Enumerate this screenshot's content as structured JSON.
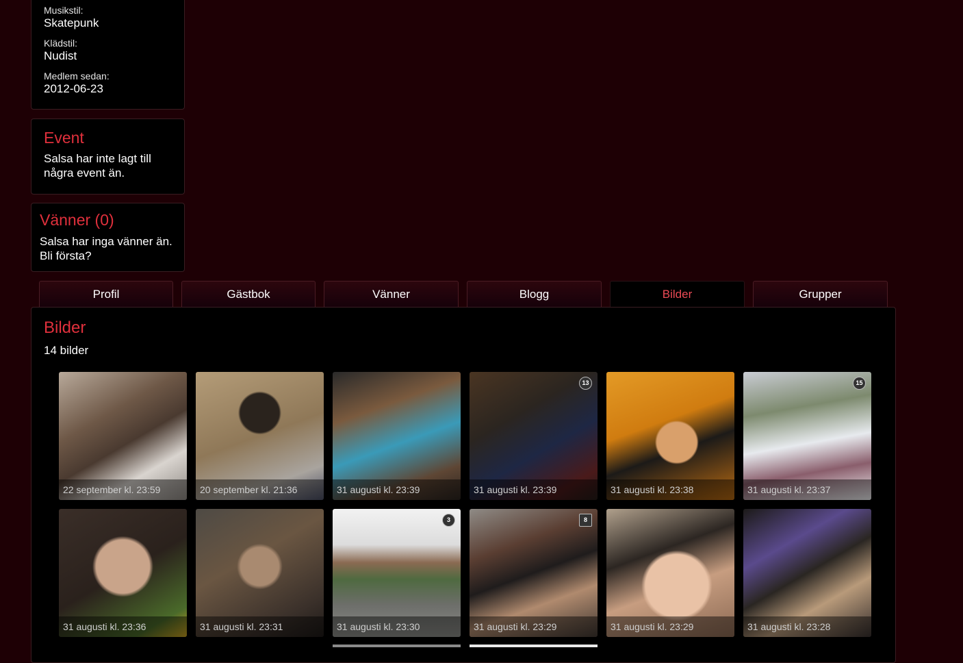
{
  "profile_info": {
    "music_label": "Musikstil:",
    "music_value": "Skatepunk",
    "style_label": "Klädstil:",
    "style_value": "Nudist",
    "member_label": "Medlem sedan:",
    "member_value": "2012-06-23"
  },
  "event": {
    "heading": "Event",
    "text_line1": "Salsa har inte lagt till",
    "text_line2": "några event än."
  },
  "friends_box": {
    "heading": "Vänner (0)",
    "text_line1": "Salsa har inga vänner än.",
    "text_line2": "Bli första?"
  },
  "tabs": [
    {
      "label": "Profil"
    },
    {
      "label": "Gästbok"
    },
    {
      "label": "Vänner"
    },
    {
      "label": "Blogg"
    },
    {
      "label": "Bilder",
      "active": true
    },
    {
      "label": "Grupper"
    }
  ],
  "pictures": {
    "heading": "Bilder",
    "count": "14 bilder",
    "items": [
      {
        "caption": "22 september kl. 23:59"
      },
      {
        "caption": "20 september kl. 21:36"
      },
      {
        "caption": "31 augusti kl. 23:39"
      },
      {
        "caption": "31 augusti kl. 23:39",
        "badge": "13"
      },
      {
        "caption": "31 augusti kl. 23:38"
      },
      {
        "caption": "31 augusti kl. 23:37",
        "badge": "15"
      },
      {
        "caption": "31 augusti kl. 23:36"
      },
      {
        "caption": "31 augusti kl. 23:31"
      },
      {
        "caption": "31 augusti kl. 23:30",
        "badge": "3"
      },
      {
        "caption": "31 augusti kl. 23:29",
        "badge": "8"
      },
      {
        "caption": "31 augusti kl. 23:29"
      },
      {
        "caption": "31 augusti kl. 23:28"
      }
    ]
  },
  "colors": {
    "page_bg": "#1e0005",
    "heading_red": "#e0303c",
    "active_tab_text": "#ec4a55"
  }
}
